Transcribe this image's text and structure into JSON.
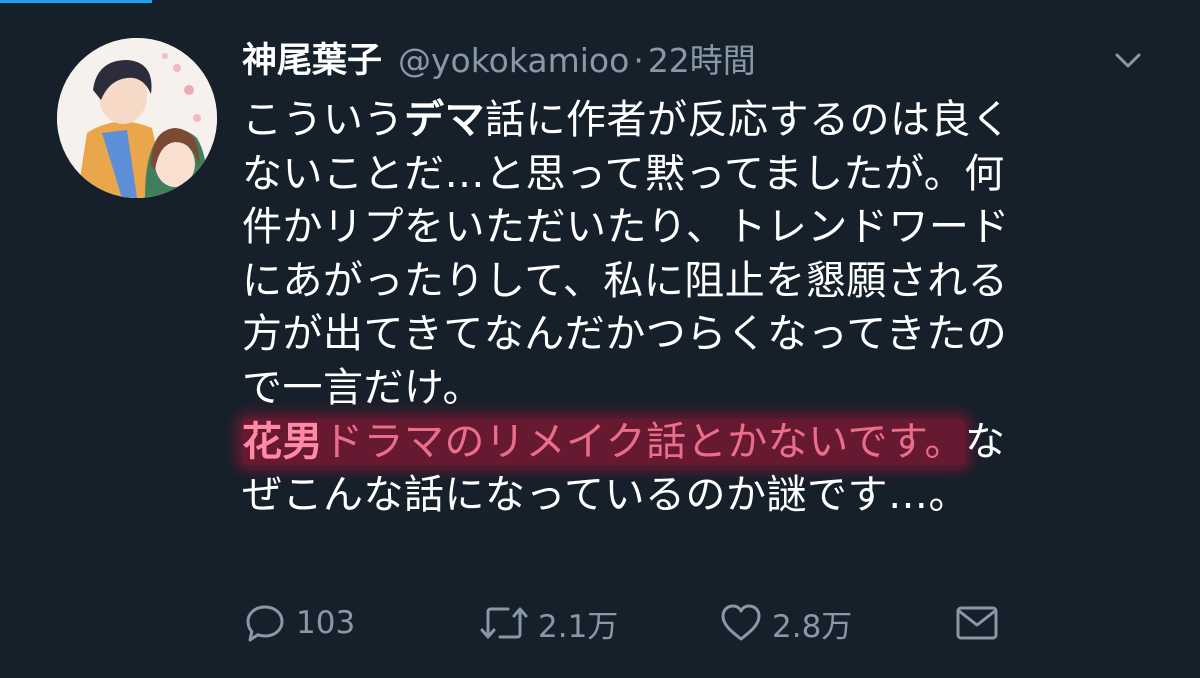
{
  "user": {
    "display_name": "神尾葉子",
    "handle": "@yokokamioo",
    "separator": "·",
    "time": "22時間"
  },
  "tweet": {
    "lines": [
      [
        {
          "t": "こういう"
        },
        {
          "t": "デマ",
          "b": true
        },
        {
          "t": "話に作者が反応するのは良く"
        }
      ],
      [
        {
          "t": "ないことだ…と思って黙ってましたが。何"
        }
      ],
      [
        {
          "t": "件かリプをいただいたり、トレンドワード"
        }
      ],
      [
        {
          "t": "にあがったりして、私に阻止を懇願される"
        }
      ],
      [
        {
          "t": "方が出てきてなんだかつらくなってきたの"
        }
      ],
      [
        {
          "t": "で一言だけ。"
        }
      ],
      [
        {
          "t": "花男",
          "b": true,
          "hl": true
        },
        {
          "t": "ドラマのリメイク話とかないです。",
          "hl": true
        },
        {
          "t": "な"
        }
      ],
      [
        {
          "t": "ぜこんな話になっているのか謎です…。"
        }
      ]
    ]
  },
  "actions": {
    "reply_count": "103",
    "retweet_count": "2.1万",
    "like_count": "2.8万"
  },
  "colors": {
    "background": "#15202b",
    "secondary_text": "#8899a6",
    "highlight": "#aa1437"
  }
}
